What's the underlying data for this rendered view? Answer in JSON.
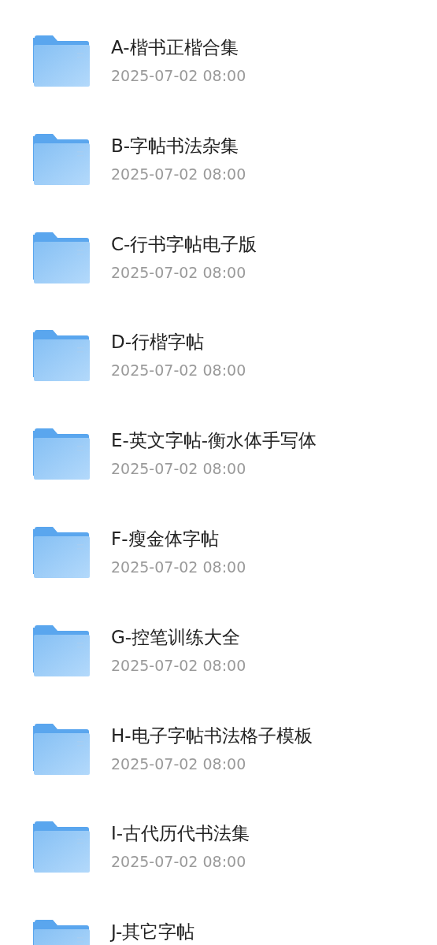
{
  "files": [
    {
      "name": "A-楷书正楷合集",
      "date": "2025-07-02 08:00"
    },
    {
      "name": "B-字帖书法杂集",
      "date": "2025-07-02 08:00"
    },
    {
      "name": "C-行书字帖电子版",
      "date": "2025-07-02 08:00"
    },
    {
      "name": "D-行楷字帖",
      "date": "2025-07-02 08:00"
    },
    {
      "name": "E-英文字帖-衡水体手写体",
      "date": "2025-07-02 08:00"
    },
    {
      "name": "F-瘦金体字帖",
      "date": "2025-07-02 08:00"
    },
    {
      "name": "G-控笔训练大全",
      "date": "2025-07-02 08:00"
    },
    {
      "name": "H-电子字帖书法格子模板",
      "date": "2025-07-02 08:00"
    },
    {
      "name": "I-古代历代书法集",
      "date": "2025-07-02 08:00"
    },
    {
      "name": "J-其它字帖"
    }
  ]
}
